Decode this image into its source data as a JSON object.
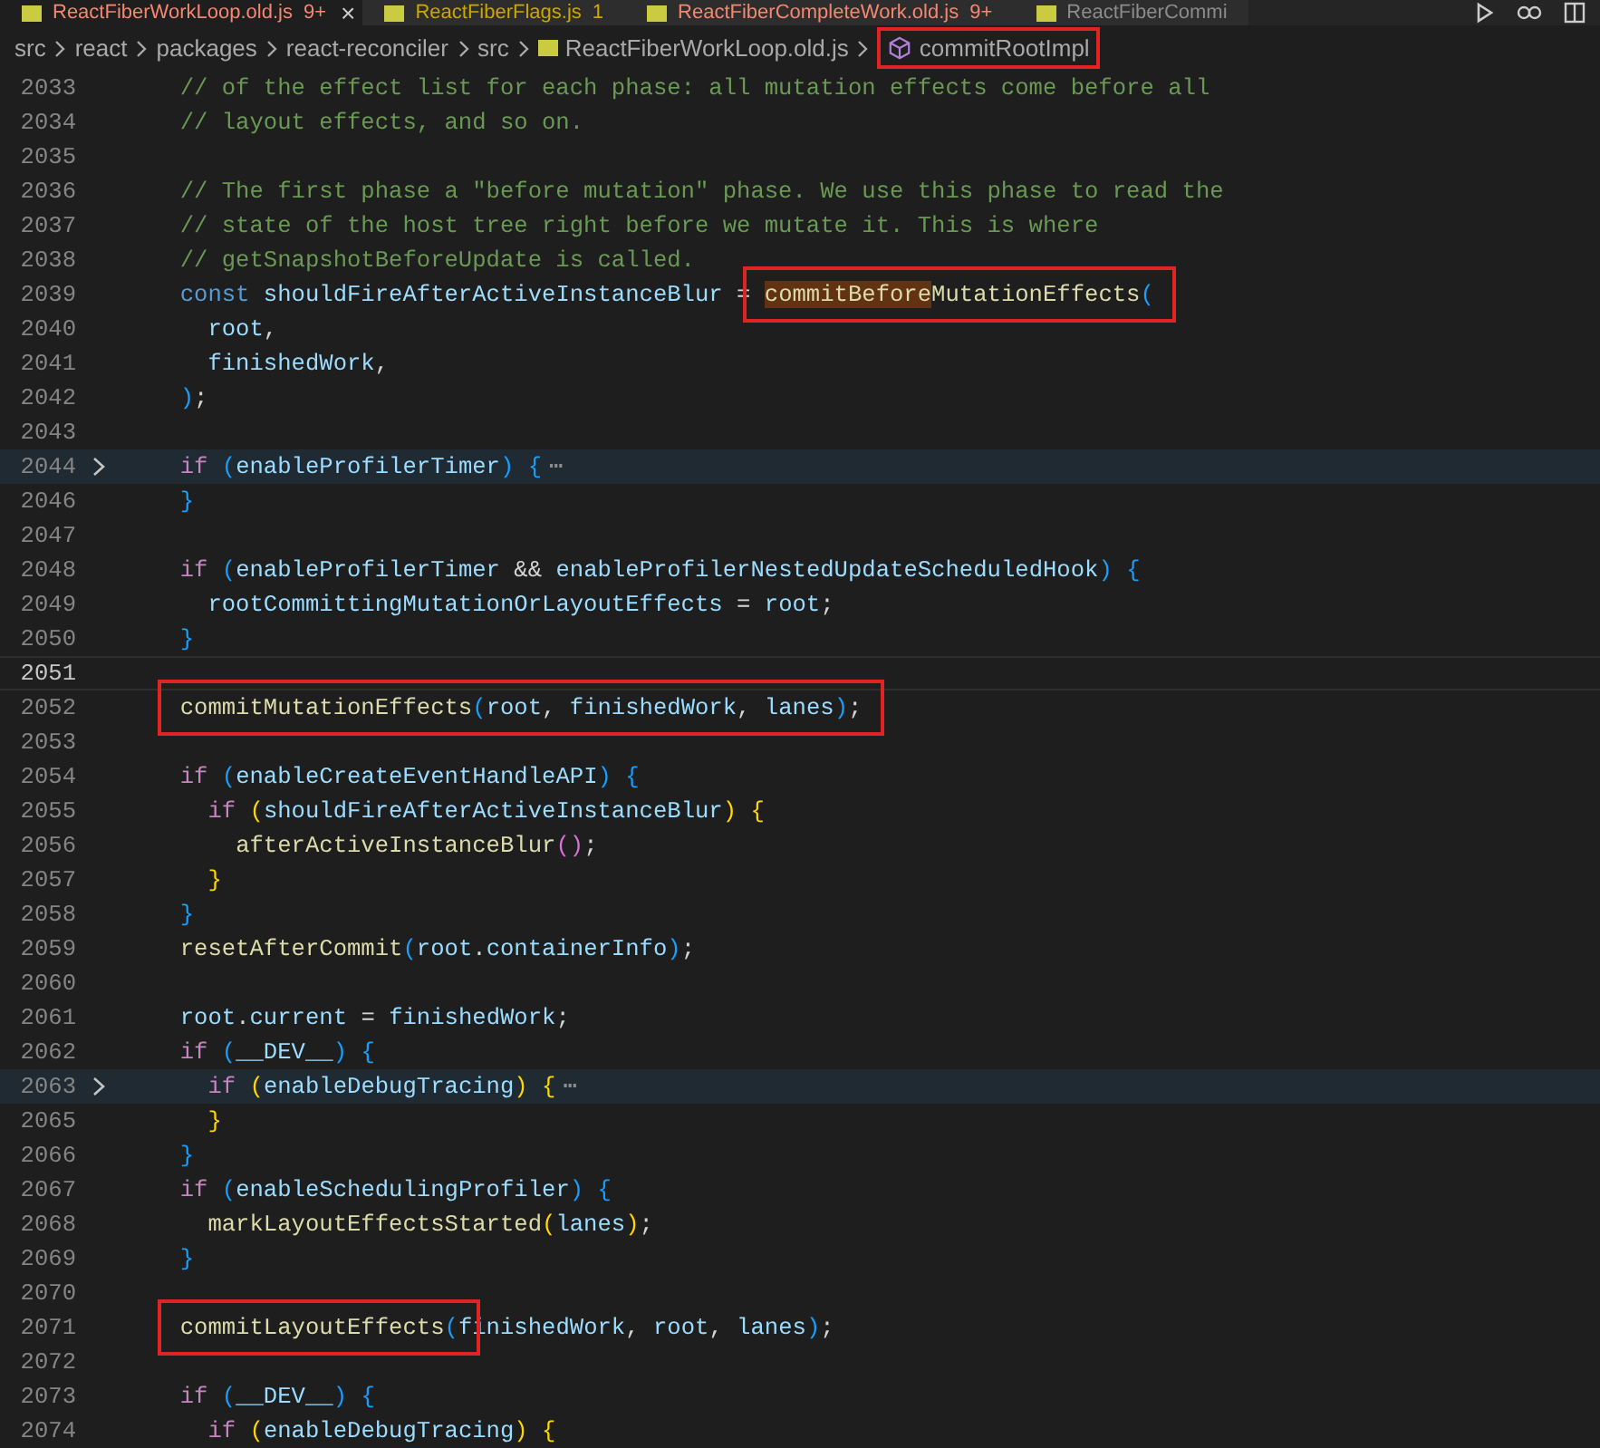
{
  "tabs": [
    {
      "label": "ReactFiberWorkLoop.old.js",
      "badge": "9+",
      "color": "#f48771",
      "selected": true,
      "close": "×"
    },
    {
      "label": "ReactFiberFlags.js",
      "badge": "1",
      "color": "#cca700",
      "selected": false
    },
    {
      "label": "ReactFiberCompleteWork.old.js",
      "badge": "9+",
      "color": "#f48771",
      "selected": false
    },
    {
      "label": "ReactFiberCommi",
      "color": "#8b8b8b",
      "selected": false
    }
  ],
  "breadcrumbs": [
    {
      "label": "src",
      "kind": "folder",
      "boxed": false
    },
    {
      "label": "react",
      "kind": "folder",
      "boxed": false
    },
    {
      "label": "packages",
      "kind": "folder",
      "boxed": false
    },
    {
      "label": "react-reconciler",
      "kind": "folder",
      "boxed": false
    },
    {
      "label": "src",
      "kind": "folder",
      "boxed": false
    },
    {
      "label": "ReactFiberWorkLoop.old.js",
      "kind": "file",
      "boxed": false
    },
    {
      "label": "commitRootImpl",
      "kind": "symbol",
      "boxed": true
    }
  ],
  "lines": [
    {
      "number": "2033",
      "tokens": [
        {
          "kind": "comment",
          "t": "  // of the effect list for each phase: all mutation effects come before all"
        }
      ]
    },
    {
      "number": "2034",
      "tokens": [
        {
          "kind": "comment",
          "t": "  // layout effects, and so on."
        }
      ]
    },
    {
      "number": "2035"
    },
    {
      "number": "2036",
      "tokens": [
        {
          "kind": "comment",
          "t": "  // The first phase a \"before mutation\" phase. We use this phase to read the"
        }
      ]
    },
    {
      "number": "2037",
      "tokens": [
        {
          "kind": "comment",
          "t": "  // state of the host tree right before we mutate it. This is where"
        }
      ]
    },
    {
      "number": "2038",
      "tokens": [
        {
          "kind": "comment",
          "t": "  // getSnapshotBeforeUpdate is called."
        }
      ]
    },
    {
      "number": "2039",
      "tokens": [
        {
          "kind": "storage",
          "t": "  const "
        },
        {
          "kind": "variable",
          "t": "shouldFireAfterActiveInstanceBlur"
        },
        {
          "kind": "plain",
          "t": " = "
        },
        {
          "kind": "function",
          "t": "commitBefore",
          "highlighted": true,
          "boxed": true
        },
        {
          "kind": "function",
          "t": "MutationEffects",
          "boxed": true
        },
        {
          "kind": "bracket3",
          "t": "(",
          "boxed": true
        }
      ]
    },
    {
      "number": "2040",
      "tokens": [
        {
          "kind": "variable",
          "t": "    root"
        },
        {
          "kind": "plain",
          "t": ","
        }
      ]
    },
    {
      "number": "2041",
      "tokens": [
        {
          "kind": "variable",
          "t": "    finishedWork"
        },
        {
          "kind": "plain",
          "t": ","
        }
      ]
    },
    {
      "number": "2042",
      "tokens": [
        {
          "kind": "bracket3",
          "t": "  )"
        },
        {
          "kind": "plain",
          "t": ";"
        }
      ]
    },
    {
      "number": "2043"
    },
    {
      "number": "2044",
      "folded": true,
      "tokens": [
        {
          "kind": "keyword",
          "t": "  if "
        },
        {
          "kind": "bracket3",
          "t": "("
        },
        {
          "kind": "variable",
          "t": "enableProfilerTimer"
        },
        {
          "kind": "bracket3",
          "t": ") {"
        },
        {
          "kind": "ellipsis",
          "t": "⋯"
        }
      ]
    },
    {
      "number": "2046",
      "tokens": [
        {
          "kind": "bracket3",
          "t": "  }"
        }
      ]
    },
    {
      "number": "2047"
    },
    {
      "number": "2048",
      "tokens": [
        {
          "kind": "keyword",
          "t": "  if "
        },
        {
          "kind": "bracket3",
          "t": "("
        },
        {
          "kind": "variable",
          "t": "enableProfilerTimer"
        },
        {
          "kind": "plain",
          "t": " && "
        },
        {
          "kind": "variable",
          "t": "enableProfilerNestedUpdateScheduledHook"
        },
        {
          "kind": "bracket3",
          "t": ") {"
        }
      ]
    },
    {
      "number": "2049",
      "tokens": [
        {
          "kind": "variable",
          "t": "    rootCommittingMutationOrLayoutEffects"
        },
        {
          "kind": "plain",
          "t": " = "
        },
        {
          "kind": "variable",
          "t": "root"
        },
        {
          "kind": "plain",
          "t": ";"
        }
      ]
    },
    {
      "number": "2050",
      "tokens": [
        {
          "kind": "bracket3",
          "t": "  }"
        }
      ]
    },
    {
      "number": "2051",
      "cursor": true
    },
    {
      "number": "2052",
      "tokens": [
        {
          "kind": "function",
          "t": "  commitMutationEffects",
          "boxed": true
        },
        {
          "kind": "bracket3",
          "t": "(",
          "boxed": true
        },
        {
          "kind": "variable",
          "t": "root",
          "boxed": true
        },
        {
          "kind": "plain",
          "t": ", ",
          "boxed": true
        },
        {
          "kind": "variable",
          "t": "finishedWork",
          "boxed": true
        },
        {
          "kind": "plain",
          "t": ", ",
          "boxed": true
        },
        {
          "kind": "variable",
          "t": "lanes",
          "boxed": true
        },
        {
          "kind": "bracket3",
          "t": ")",
          "boxed": true
        },
        {
          "kind": "plain",
          "t": ";",
          "boxed": true
        }
      ]
    },
    {
      "number": "2053"
    },
    {
      "number": "2054",
      "tokens": [
        {
          "kind": "keyword",
          "t": "  if "
        },
        {
          "kind": "bracket3",
          "t": "("
        },
        {
          "kind": "variable",
          "t": "enableCreateEventHandleAPI"
        },
        {
          "kind": "bracket3",
          "t": ") {"
        }
      ]
    },
    {
      "number": "2055",
      "tokens": [
        {
          "kind": "keyword",
          "t": "    if "
        },
        {
          "kind": "bracket1",
          "t": "("
        },
        {
          "kind": "variable",
          "t": "shouldFireAfterActiveInstanceBlur"
        },
        {
          "kind": "bracket1",
          "t": ") {"
        }
      ]
    },
    {
      "number": "2056",
      "tokens": [
        {
          "kind": "function",
          "t": "      afterActiveInstanceBlur"
        },
        {
          "kind": "bracket2",
          "t": "()"
        },
        {
          "kind": "plain",
          "t": ";"
        }
      ]
    },
    {
      "number": "2057",
      "tokens": [
        {
          "kind": "bracket1",
          "t": "    }"
        }
      ]
    },
    {
      "number": "2058",
      "tokens": [
        {
          "kind": "bracket3",
          "t": "  }"
        }
      ]
    },
    {
      "number": "2059",
      "tokens": [
        {
          "kind": "function",
          "t": "  resetAfterCommit"
        },
        {
          "kind": "bracket3",
          "t": "("
        },
        {
          "kind": "variable",
          "t": "root"
        },
        {
          "kind": "plain",
          "t": "."
        },
        {
          "kind": "variable",
          "t": "containerInfo"
        },
        {
          "kind": "bracket3",
          "t": ")"
        },
        {
          "kind": "plain",
          "t": ";"
        }
      ]
    },
    {
      "number": "2060"
    },
    {
      "number": "2061",
      "tokens": [
        {
          "kind": "variable",
          "t": "  root"
        },
        {
          "kind": "plain",
          "t": "."
        },
        {
          "kind": "variable",
          "t": "current"
        },
        {
          "kind": "plain",
          "t": " = "
        },
        {
          "kind": "variable",
          "t": "finishedWork"
        },
        {
          "kind": "plain",
          "t": ";"
        }
      ]
    },
    {
      "number": "2062",
      "tokens": [
        {
          "kind": "keyword",
          "t": "  if "
        },
        {
          "kind": "bracket3",
          "t": "("
        },
        {
          "kind": "variable",
          "t": "__DEV__"
        },
        {
          "kind": "bracket3",
          "t": ") {"
        }
      ]
    },
    {
      "number": "2063",
      "folded": true,
      "tokens": [
        {
          "kind": "keyword",
          "t": "    if "
        },
        {
          "kind": "bracket1",
          "t": "("
        },
        {
          "kind": "variable",
          "t": "enableDebugTracing"
        },
        {
          "kind": "bracket1",
          "t": ") {"
        },
        {
          "kind": "ellipsis",
          "t": "⋯"
        }
      ]
    },
    {
      "number": "2065",
      "tokens": [
        {
          "kind": "bracket1",
          "t": "    }"
        }
      ]
    },
    {
      "number": "2066",
      "tokens": [
        {
          "kind": "bracket3",
          "t": "  }"
        }
      ]
    },
    {
      "number": "2067",
      "tokens": [
        {
          "kind": "keyword",
          "t": "  if "
        },
        {
          "kind": "bracket3",
          "t": "("
        },
        {
          "kind": "variable",
          "t": "enableSchedulingProfiler"
        },
        {
          "kind": "bracket3",
          "t": ") {"
        }
      ]
    },
    {
      "number": "2068",
      "tokens": [
        {
          "kind": "function",
          "t": "    markLayoutEffectsStarted"
        },
        {
          "kind": "bracket1",
          "t": "("
        },
        {
          "kind": "variable",
          "t": "lanes"
        },
        {
          "kind": "bracket1",
          "t": ")"
        },
        {
          "kind": "plain",
          "t": ";"
        }
      ]
    },
    {
      "number": "2069",
      "tokens": [
        {
          "kind": "bracket3",
          "t": "  }"
        }
      ]
    },
    {
      "number": "2070"
    },
    {
      "number": "2071",
      "tokens": [
        {
          "kind": "function",
          "t": "  commitLayoutEffects",
          "boxed": true
        },
        {
          "kind": "bracket3",
          "t": "(",
          "boxed": true
        },
        {
          "kind": "variable",
          "t": "finishedWork"
        },
        {
          "kind": "plain",
          "t": ", "
        },
        {
          "kind": "variable",
          "t": "root"
        },
        {
          "kind": "plain",
          "t": ", "
        },
        {
          "kind": "variable",
          "t": "lanes"
        },
        {
          "kind": "bracket3",
          "t": ")"
        },
        {
          "kind": "plain",
          "t": ";"
        }
      ]
    },
    {
      "number": "2072"
    },
    {
      "number": "2073",
      "tokens": [
        {
          "kind": "keyword",
          "t": "  if "
        },
        {
          "kind": "bracket3",
          "t": "("
        },
        {
          "kind": "variable",
          "t": "__DEV__"
        },
        {
          "kind": "bracket3",
          "t": ") {"
        }
      ]
    },
    {
      "number": "2074",
      "tokens": [
        {
          "kind": "keyword",
          "t": "    if "
        },
        {
          "kind": "bracket1",
          "t": "("
        },
        {
          "kind": "variable",
          "t": "enableDebugTracing"
        },
        {
          "kind": "bracket1",
          "t": ") {"
        }
      ]
    }
  ]
}
